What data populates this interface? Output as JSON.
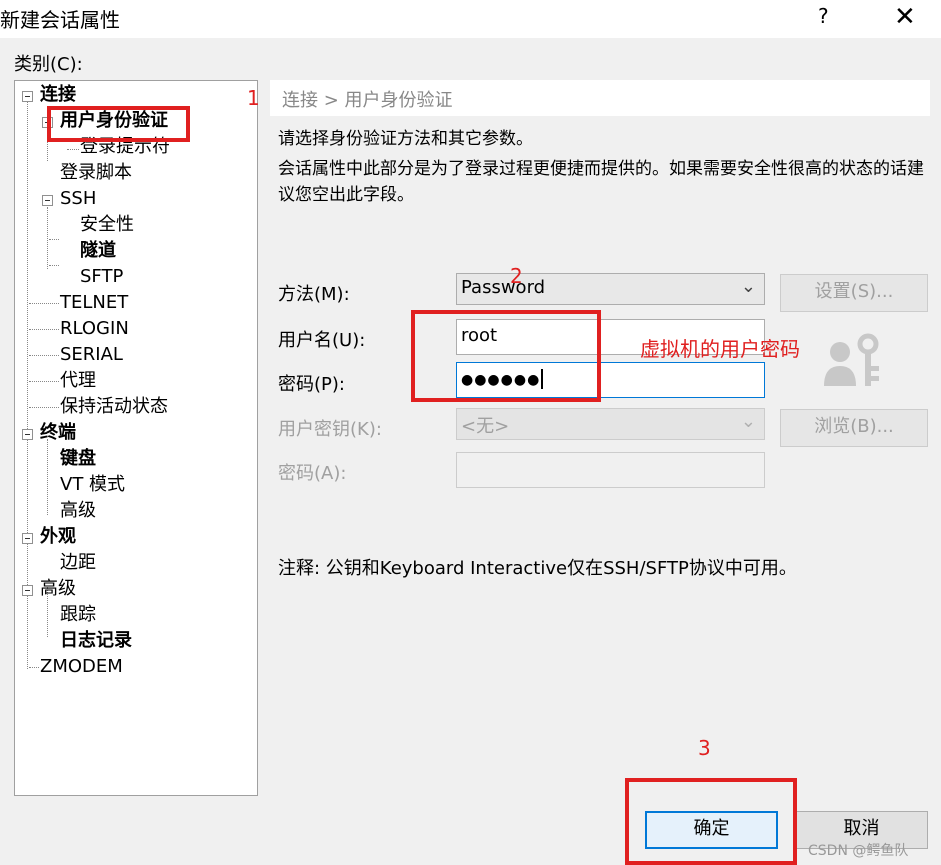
{
  "window": {
    "title": "新建会话属性",
    "help": "?",
    "close": "✕"
  },
  "category_label": "类别(C):",
  "tree": [
    {
      "label": "连接",
      "bold": true
    },
    {
      "label": "用户身份验证",
      "bold": true
    },
    {
      "label": "登录提示符"
    },
    {
      "label": "登录脚本"
    },
    {
      "label": "SSH"
    },
    {
      "label": "安全性"
    },
    {
      "label": "隧道",
      "bold": true
    },
    {
      "label": "SFTP"
    },
    {
      "label": "TELNET"
    },
    {
      "label": "RLOGIN"
    },
    {
      "label": "SERIAL"
    },
    {
      "label": "代理"
    },
    {
      "label": "保持活动状态"
    },
    {
      "label": "终端",
      "bold": true
    },
    {
      "label": "键盘",
      "bold": true
    },
    {
      "label": "VT 模式"
    },
    {
      "label": "高级"
    },
    {
      "label": "外观",
      "bold": true
    },
    {
      "label": "边距"
    },
    {
      "label": "高级"
    },
    {
      "label": "跟踪"
    },
    {
      "label": "日志记录",
      "bold": true
    },
    {
      "label": "ZMODEM"
    }
  ],
  "breadcrumb": "连接 > 用户身份验证",
  "desc1": "请选择身份验证方法和其它参数。",
  "desc2": "会话属性中此部分是为了登录过程更便捷而提供的。如果需要安全性很高的状态的话建议您空出此字段。",
  "form": {
    "method_label": "方法(M):",
    "method_value": "Password",
    "settings_button": "设置(S)...",
    "username_label": "用户名(U):",
    "username_value": "root",
    "password_label": "密码(P):",
    "password_value": "●●●●●●",
    "userkey_label": "用户密钥(K):",
    "userkey_value": "<无>",
    "browse_button": "浏览(B)...",
    "passphrase_label": "密码(A):",
    "passphrase_value": ""
  },
  "note": "注释: 公钥和Keyboard Interactive仅在SSH/SFTP协议中可用。",
  "buttons": {
    "ok": "确定",
    "cancel": "取消"
  },
  "annotations": {
    "n1": "1",
    "n2": "2",
    "n3": "3",
    "vm_password_note": "虚拟机的用户密码",
    "color": "#e02020"
  },
  "watermark": "CSDN @鳄鱼队",
  "icons": [
    "user-key-icon",
    "chevron-down-icon",
    "tree-collapse-icon"
  ]
}
